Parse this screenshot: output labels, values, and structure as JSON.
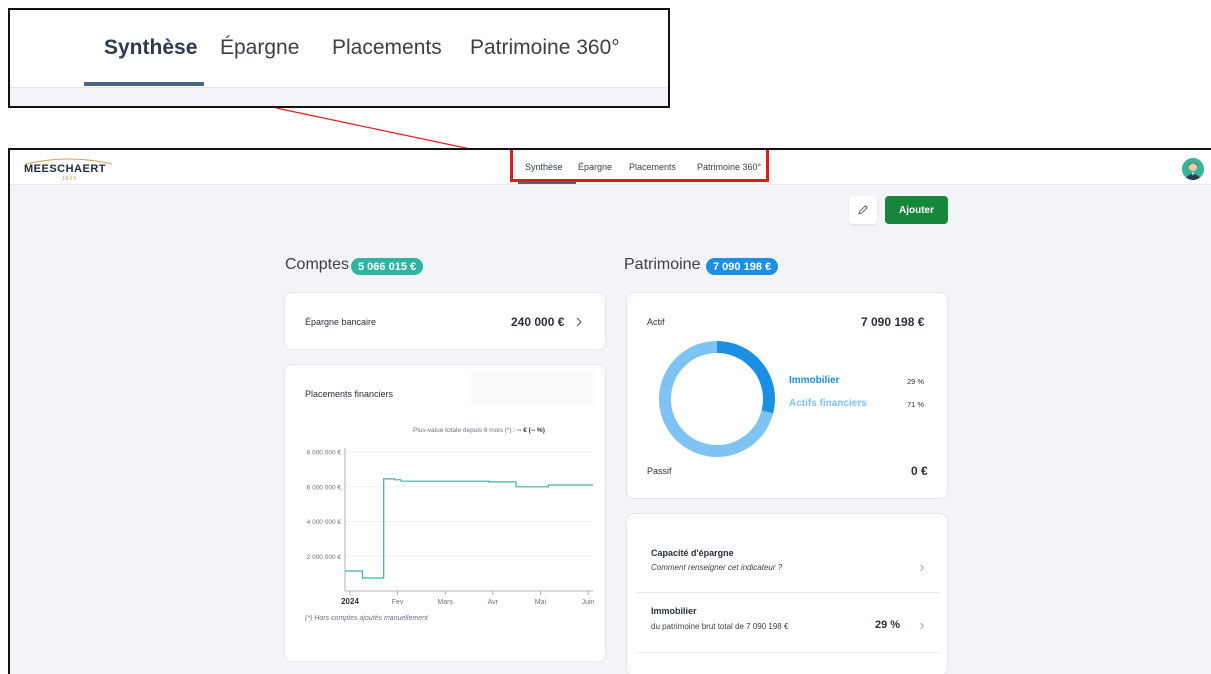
{
  "nav": {
    "tabs": [
      {
        "label": "Synthèse"
      },
      {
        "label": "Épargne"
      },
      {
        "label": "Placements"
      },
      {
        "label": "Patrimoine 360°"
      }
    ]
  },
  "logo": {
    "name": "MEESCHAERT",
    "year": "1855"
  },
  "toolbar": {
    "add_label": "Ajouter"
  },
  "comptes": {
    "title": "Comptes",
    "total": "5 066 015 €",
    "epargne_label": "Épargne bancaire",
    "epargne_value": "240 000 €",
    "placements_title": "Placements financiers",
    "plus_value_text": "Plus-value totale depuis 6 mois (*) : ",
    "plus_value_value": "-- € (-- %)",
    "footnote": "(*) Hors comptes ajoutés manuellement"
  },
  "patrimoine": {
    "title": "Patrimoine",
    "total": "7 090 198 €",
    "actif_label": "Actif",
    "actif_value": "7 090 198 €",
    "passif_label": "Passif",
    "passif_value": "0 €",
    "legend": [
      {
        "label": "Immobilier",
        "pct": "29 %",
        "value": 29,
        "color": "#1a8fe3"
      },
      {
        "label": "Actifs financiers",
        "pct": "71 %",
        "value": 71,
        "color": "#7fc3f5"
      }
    ],
    "capacite_title": "Capacité d'épargne",
    "capacite_sub": "Comment renseigner cet indicateur ?",
    "immobilier_title": "Immobilier",
    "immobilier_sub": "du patrimoine brut total de 7 090 198 €",
    "immobilier_pct": "29 %"
  },
  "colors": {
    "comptes_pill": "#2fb3a3",
    "patrimoine_pill": "#1a8fe3",
    "line": "#3bb3a6",
    "add_button": "#16873a"
  },
  "chart_data": {
    "type": "line",
    "y_ticks": [
      "8 000 000 €",
      "6 000 000 €",
      "4 000 000 €",
      "2 000 000 €"
    ],
    "x_ticks": [
      "2024",
      "Fev",
      "Mars",
      "Avr",
      "Mai",
      "Juin"
    ],
    "ylim": [
      0,
      8000000
    ],
    "series": [
      {
        "x": [
          0,
          0.35,
          0.35,
          0.78,
          0.78,
          1.0,
          1.0,
          1.13,
          1.13,
          2.9,
          2.9,
          3.45,
          3.45,
          4.1,
          4.1,
          5.0
        ],
        "values": [
          1150000,
          1150000,
          750000,
          750000,
          6450000,
          6450000,
          6400000,
          6400000,
          6320000,
          6320000,
          6280000,
          6280000,
          6000000,
          6000000,
          6100000,
          6100000
        ]
      }
    ]
  }
}
